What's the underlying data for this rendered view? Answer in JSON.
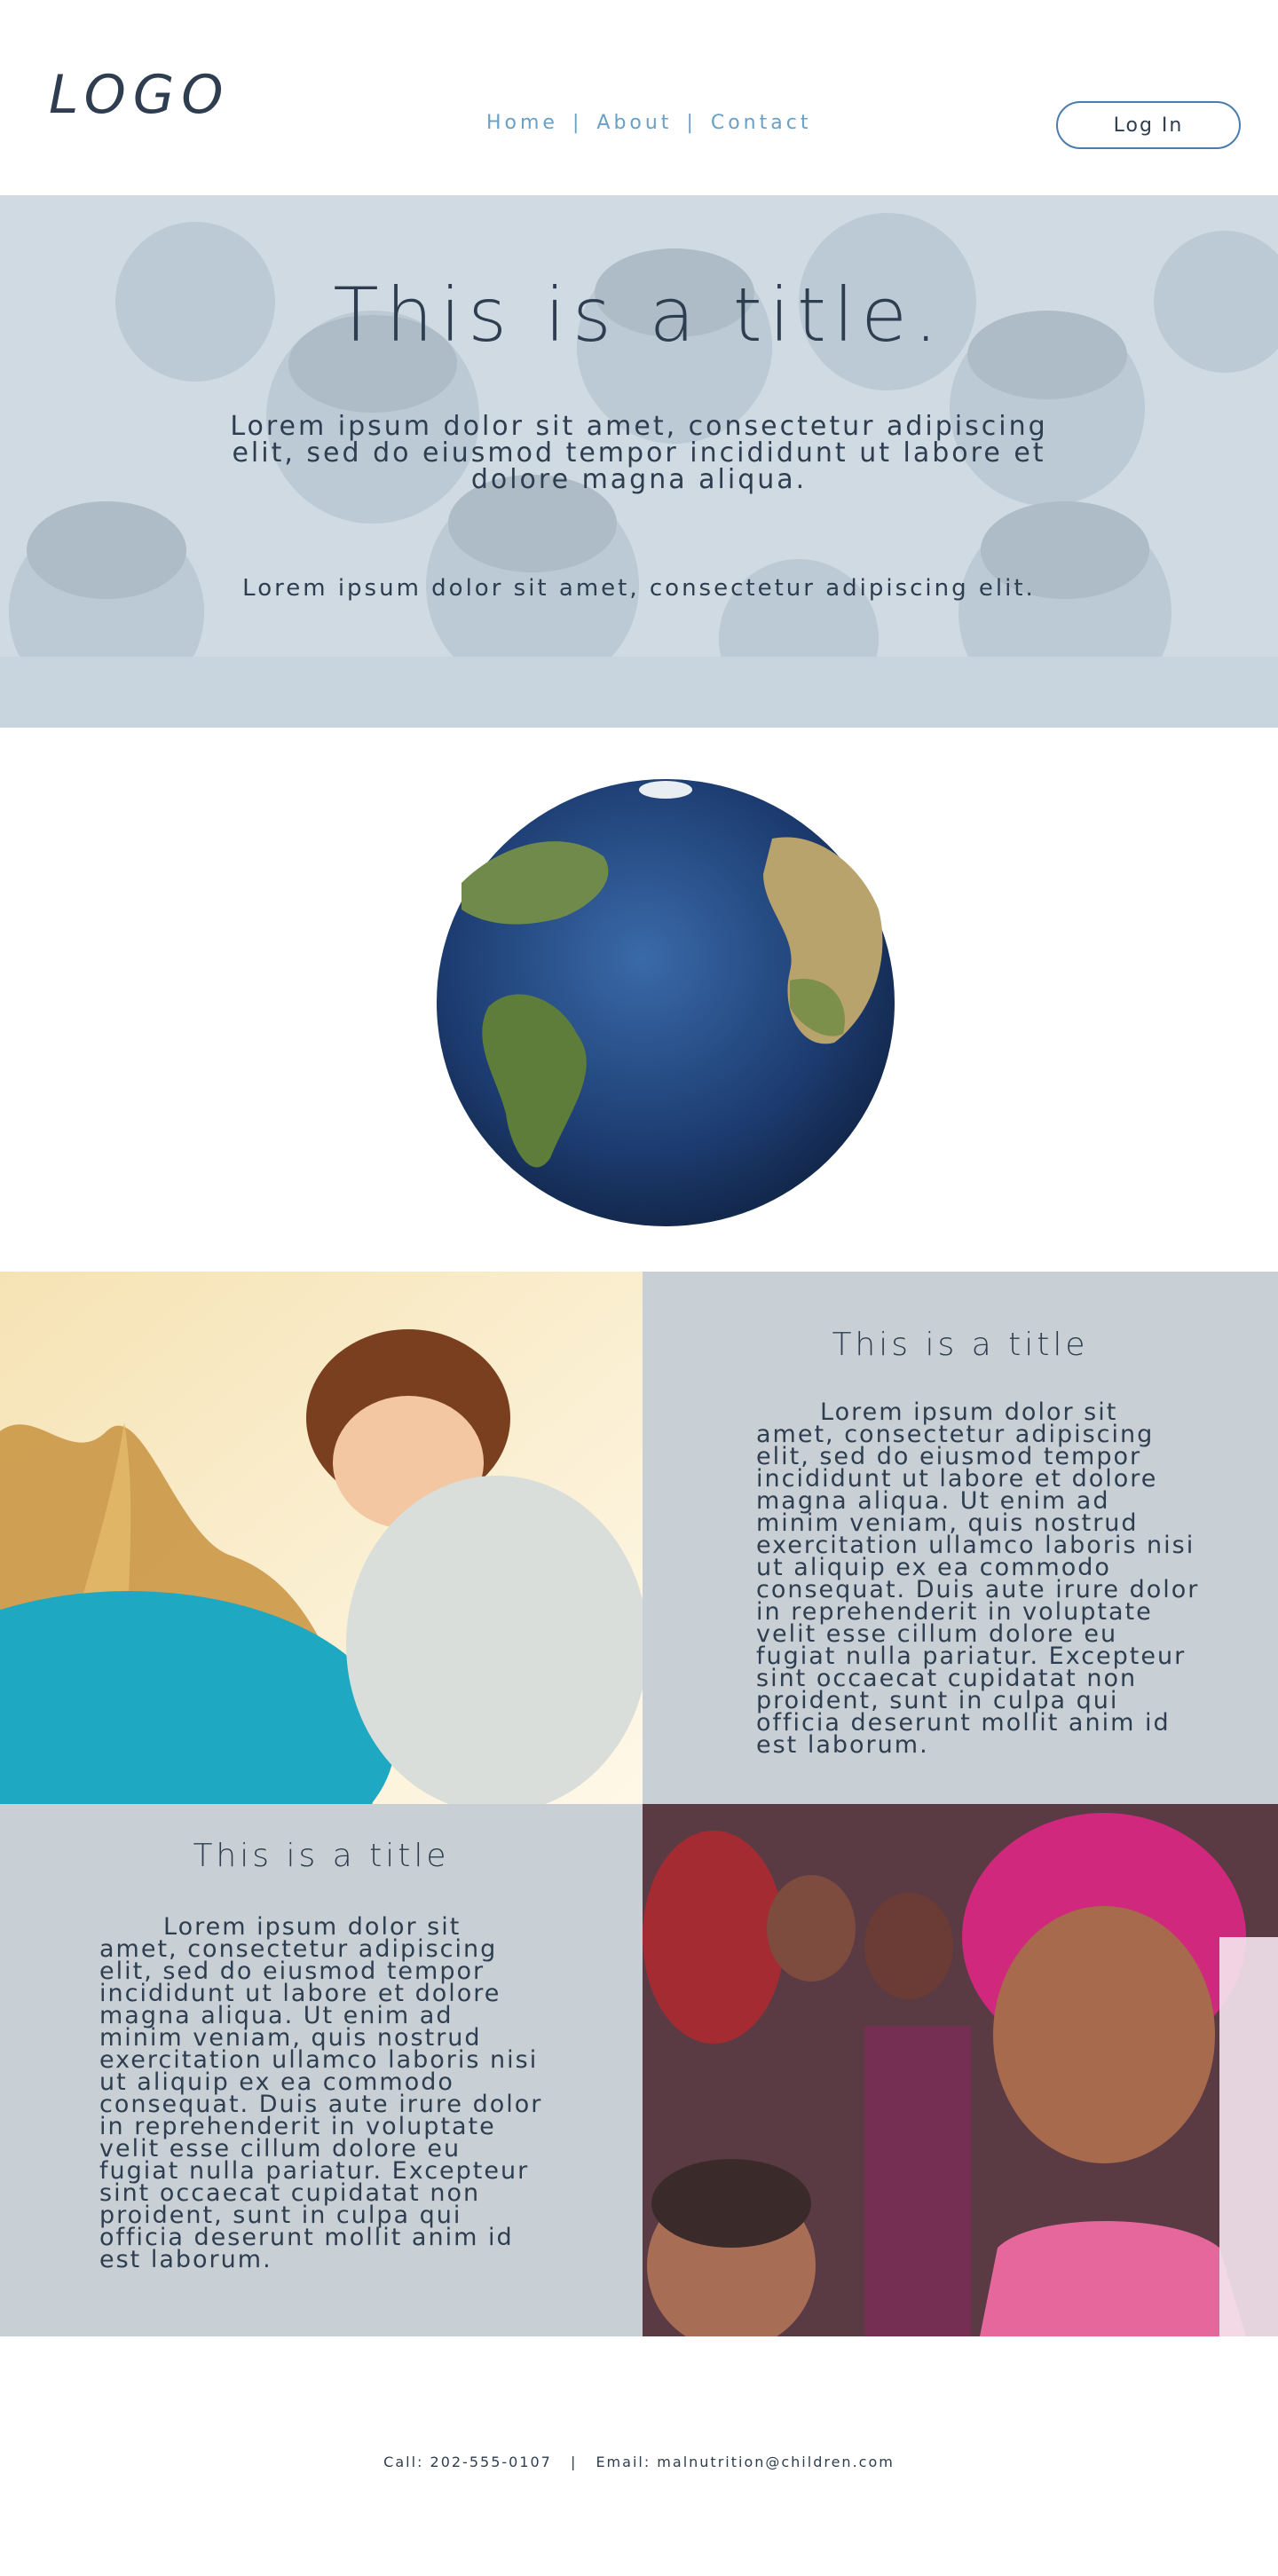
{
  "header": {
    "logo_text": "LOGO",
    "nav": {
      "home": "Home",
      "about": "About",
      "contact": "Contact",
      "separator": "|"
    },
    "login_label": "Log In"
  },
  "hero": {
    "title": "This is a title.",
    "paragraph": "Lorem ipsum dolor sit amet, consectetur adipiscing elit, sed do eiusmod tempor incididunt ut labore et dolore magna aliqua.",
    "subtitle": "Lorem ipsum dolor sit amet, consectetur adipiscing elit."
  },
  "feature_one": {
    "title": "This is a title",
    "text": "Lorem ipsum dolor sit amet, consectetur adipiscing elit, sed do eiusmod tempor incididunt ut labore et dolore magna aliqua. Ut enim ad minim veniam, quis nostrud exercitation ullamco laboris nisi ut aliquip ex ea commodo consequat. Duis aute irure dolor in reprehenderit in voluptate velit esse cillum dolore eu fugiat nulla pariatur. Excepteur sint occaecat cupidatat non proident, sunt in culpa qui officia deserunt mollit anim id est laborum."
  },
  "feature_two": {
    "title": "This is a title",
    "text": "Lorem ipsum dolor sit amet, consectetur adipiscing elit, sed do eiusmod tempor incididunt ut labore et dolore magna aliqua. Ut enim ad minim veniam, quis nostrud exercitation ullamco laboris nisi ut aliquip ex ea commodo consequat. Duis aute irure dolor in reprehenderit in voluptate velit esse cillum dolore eu fugiat nulla pariatur. Excepteur sint occaecat cupidatat non proident, sunt in culpa qui officia deserunt mollit anim id est laborum."
  },
  "footer": {
    "call": "Call: 202-555-0107",
    "separator": "|",
    "email": "Email: malnutrition@children.com"
  },
  "colors": {
    "text": "#2e3e50",
    "nav": "#6aa0c4",
    "button_border": "#4a7cb0",
    "panel": "#c9d0d5"
  }
}
